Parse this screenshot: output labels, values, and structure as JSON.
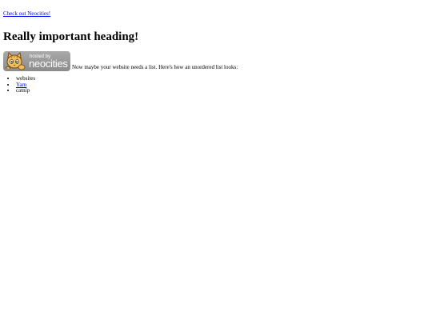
{
  "top_link": {
    "label": "Check out Neocities!"
  },
  "heading": {
    "text": "Really important heading!"
  },
  "badge": {
    "small_text": "hosted by",
    "big_text": "neocities"
  },
  "intro": {
    "text": "Now maybe your website needs a list. Here's how an unordered list looks:"
  },
  "list": {
    "items": [
      {
        "label": "websites",
        "is_link": false
      },
      {
        "label": "Yarn",
        "is_link": true
      },
      {
        "label": "catnip",
        "is_link": false
      }
    ]
  }
}
